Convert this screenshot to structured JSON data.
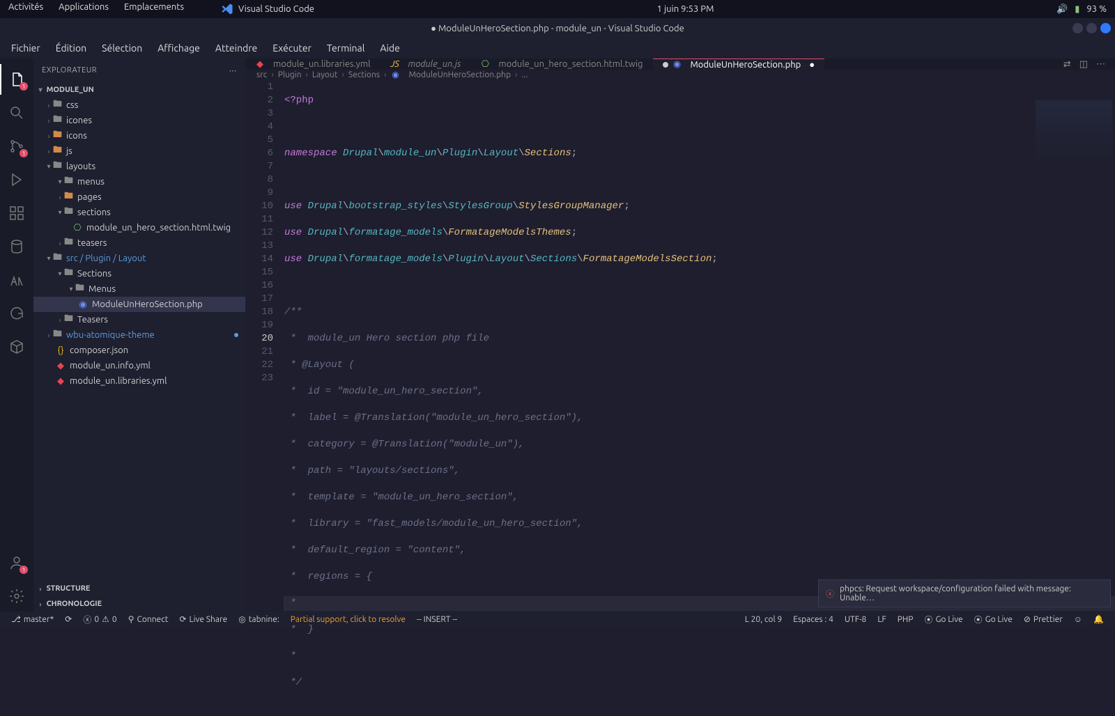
{
  "topbar": {
    "activities": "Activités",
    "applications": "Applications",
    "places": "Emplacements",
    "app": "Visual Studio Code",
    "datetime": "1 juin  9:53 PM",
    "battery": "93 %"
  },
  "title": "● ModuleUnHeroSection.php - module_un - Visual Studio Code",
  "menu": [
    "Fichier",
    "Édition",
    "Sélection",
    "Affichage",
    "Atteindre",
    "Exécuter",
    "Terminal",
    "Aide"
  ],
  "explorer": {
    "header": "EXPLORATEUR",
    "project": "MODULE_UN",
    "structure": "STRUCTURE",
    "chronologie": "CHRONOLOGIE",
    "items": {
      "css": "css",
      "icones": "icones",
      "icons": "icons",
      "js": "js",
      "layouts": "layouts",
      "menus": "menus",
      "pages": "pages",
      "sections": "sections",
      "hero_twig": "module_un_hero_section.html.twig",
      "teasers": "teasers",
      "srcpath": "src / Plugin / Layout",
      "Sections": "Sections",
      "Menus": "Menus",
      "hero_php": "ModuleUnHeroSection.php",
      "Teasers": "Teasers",
      "wbu": "wbu-atomique-theme",
      "composer": "composer.json",
      "infoyml": "module_un.info.yml",
      "libyml": "module_un.libraries.yml"
    }
  },
  "tabs": {
    "t1": "module_un.libraries.yml",
    "t2": "module_un.js",
    "t3": "module_un_hero_section.html.twig",
    "t4": "ModuleUnHeroSection.php"
  },
  "breadcrumb": [
    "src",
    "Plugin",
    "Layout",
    "Sections",
    "ModuleUnHeroSection.php",
    "..."
  ],
  "code": {
    "l1": "<?php",
    "l3_kw": "namespace ",
    "l3_n1": "Drupal",
    "l3_n2": "module_un",
    "l3_n3": "Plugin",
    "l3_n4": "Layout",
    "l3_n5": "Sections",
    "use": "use ",
    "l5_a": "Drupal",
    "l5_b": "bootstrap_styles",
    "l5_c": "StylesGroup",
    "l5_d": "StylesGroupManager",
    "l6_a": "Drupal",
    "l6_b": "formatage_models",
    "l6_c": "FormatageModelsThemes",
    "l7_a": "Drupal",
    "l7_b": "formatage_models",
    "l7_c": "Plugin",
    "l7_d": "Layout",
    "l7_e": "Sections",
    "l7_f": "FormatageModelsSection",
    "c9": "/**",
    "c10": " *  module_un Hero section php file",
    "c11": " * @Layout (",
    "c12": " *  id = \"module_un_hero_section\",",
    "c13": " *  label = @Translation(\"module_un_hero_section\"),",
    "c14": " *  category = @Translation(\"module_un\"),",
    "c15": " *  path = \"layouts/sections\",",
    "c16": " *  template = \"module_un_hero_section\",",
    "c17": " *  library = \"fast_models/module_un_hero_section\",",
    "c18": " *  default_region = \"content\",",
    "c19": " *  regions = {",
    "c20": " *",
    "c21": " *  }",
    "c22": " *",
    "c23": " */"
  },
  "status": {
    "branch": "master*",
    "sync": "⟳",
    "errs": "0",
    "warns": "0",
    "connect": "Connect",
    "liveshare": "Live Share",
    "tabnine": "tabnine:",
    "partial": "Partial support, click to resolve",
    "insert": "-- INSERT --",
    "pos": "L 20, col 9",
    "spaces": "Espaces : 4",
    "enc": "UTF-8",
    "eol": "LF",
    "lang": "PHP",
    "golive1": "Go Live",
    "golive2": "Go Live",
    "prettier": "Prettier"
  },
  "notify": "phpcs: Request workspace/configuration failed with message: Unable…"
}
